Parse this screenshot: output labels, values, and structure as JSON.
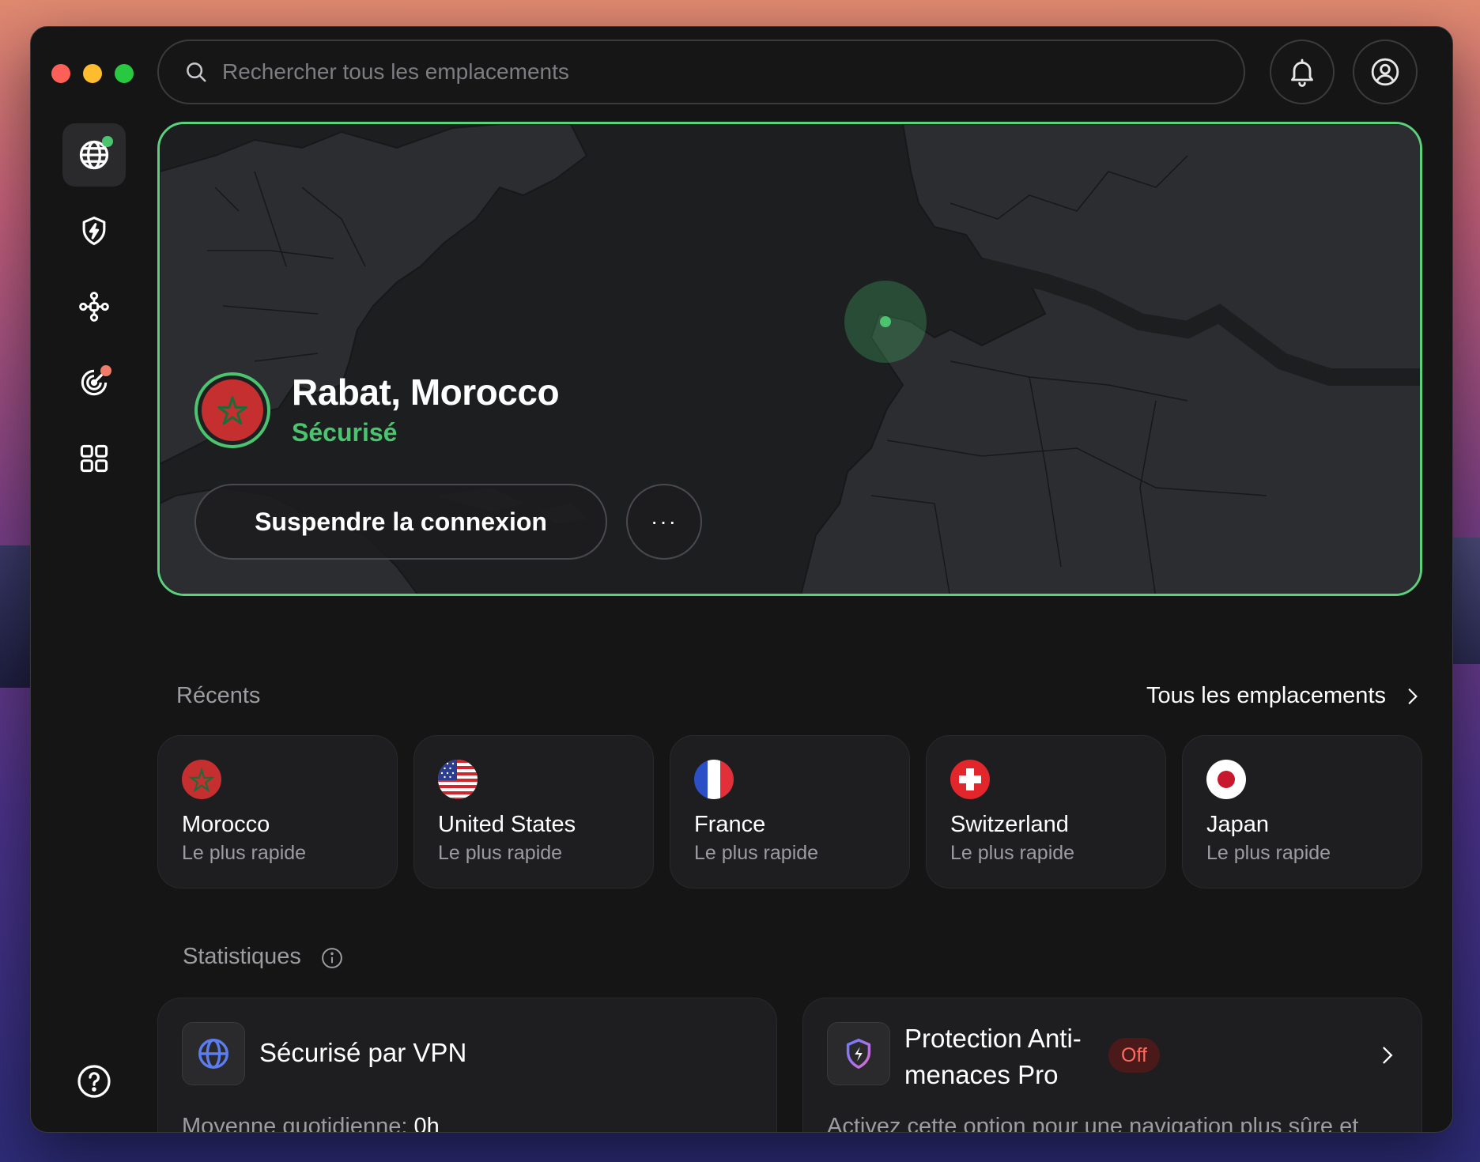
{
  "search": {
    "placeholder": "Rechercher tous les emplacements"
  },
  "hero": {
    "location": "Rabat, Morocco",
    "status": "Sécurisé",
    "pause_label": "Suspendre la connexion",
    "more_label": "···"
  },
  "recents": {
    "label": "Récents",
    "all_link": "Tous les emplacements",
    "items": [
      {
        "name": "Morocco",
        "sub": "Le plus rapide"
      },
      {
        "name": "United States",
        "sub": "Le plus rapide"
      },
      {
        "name": "France",
        "sub": "Le plus rapide"
      },
      {
        "name": "Switzerland",
        "sub": "Le plus rapide"
      },
      {
        "name": "Japan",
        "sub": "Le plus rapide"
      }
    ]
  },
  "stats": {
    "label": "Statistiques",
    "vpn": {
      "title": "Sécurisé par VPN",
      "desc_label": "Moyenne quotidienne:",
      "desc_value": "0h"
    },
    "threat": {
      "title_line1": "Protection Anti-",
      "title_line2": "menaces Pro",
      "badge": "Off",
      "desc": "Activez cette option pour une navigation plus sûre et"
    }
  },
  "colors": {
    "accent_green": "#4cc46f",
    "border_green": "#5bd17e",
    "off_red": "#ff6b5e"
  },
  "icons": [
    "search-icon",
    "bell-icon",
    "account-icon",
    "globe-icon",
    "shield-bolt-icon",
    "mesh-network-icon",
    "target-icon",
    "grid-icon",
    "help-icon",
    "info-icon",
    "chevron-right-icon"
  ]
}
